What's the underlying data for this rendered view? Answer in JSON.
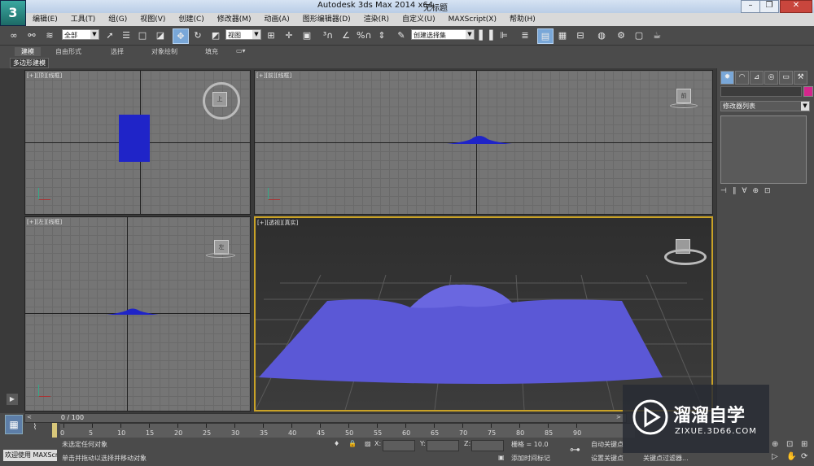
{
  "app": {
    "logo": "3",
    "title": "Autodesk 3ds Max  2014 x64",
    "document": "无标题"
  },
  "window_buttons": [
    "–",
    "❐",
    "✕"
  ],
  "menu": [
    "编辑(E)",
    "工具(T)",
    "组(G)",
    "视图(V)",
    "创建(C)",
    "修改器(M)",
    "动画(A)",
    "图形编辑器(D)",
    "渲染(R)",
    "自定义(U)",
    "MAXScript(X)",
    "帮助(H)"
  ],
  "toolbar": {
    "selection_filter": "全部",
    "coord_system": "视图",
    "named_selection": "创建选择集"
  },
  "ribbon": {
    "tabs": [
      "建模",
      "自由形式",
      "选择",
      "对象绘制",
      "填充"
    ],
    "subtab": "多边形建模"
  },
  "viewports": {
    "top": {
      "label": "[+][顶][线框]",
      "cube": "上"
    },
    "front": {
      "label": "[+][前][线框]",
      "cube": "前"
    },
    "left": {
      "label": "[+][左][线框]",
      "cube": "左"
    },
    "persp": {
      "label": "[+][透视][真实]"
    }
  },
  "command_panel": {
    "modifier_list": "修改器列表"
  },
  "timeline": {
    "frame": "0 / 100",
    "ticks": [
      "0",
      "5",
      "10",
      "15",
      "20",
      "25",
      "30",
      "35",
      "40",
      "45",
      "50",
      "55",
      "60",
      "65",
      "70",
      "75",
      "80",
      "85",
      "90"
    ]
  },
  "status": {
    "maxscript_label": "欢迎使用 MAXScr",
    "line1": "未选定任何对象",
    "line2": "单击并拖动以选择并移动对象",
    "x_label": "X:",
    "y_label": "Y:",
    "z_label": "Z:",
    "grid": "栅格 = 10.0",
    "add_time_tag": "添加时间标记",
    "auto_key": "自动关键点",
    "set_key": "设置关键点",
    "key_filter": "关键点过滤器..."
  },
  "watermark": {
    "title": "溜溜自学",
    "url": "ZIXUE.3D66.COM"
  },
  "colors": {
    "plane": "#5b58d6",
    "box": "#1f24c8",
    "active_border": "#c9a227",
    "toolbar_active": "#79a7d8"
  }
}
